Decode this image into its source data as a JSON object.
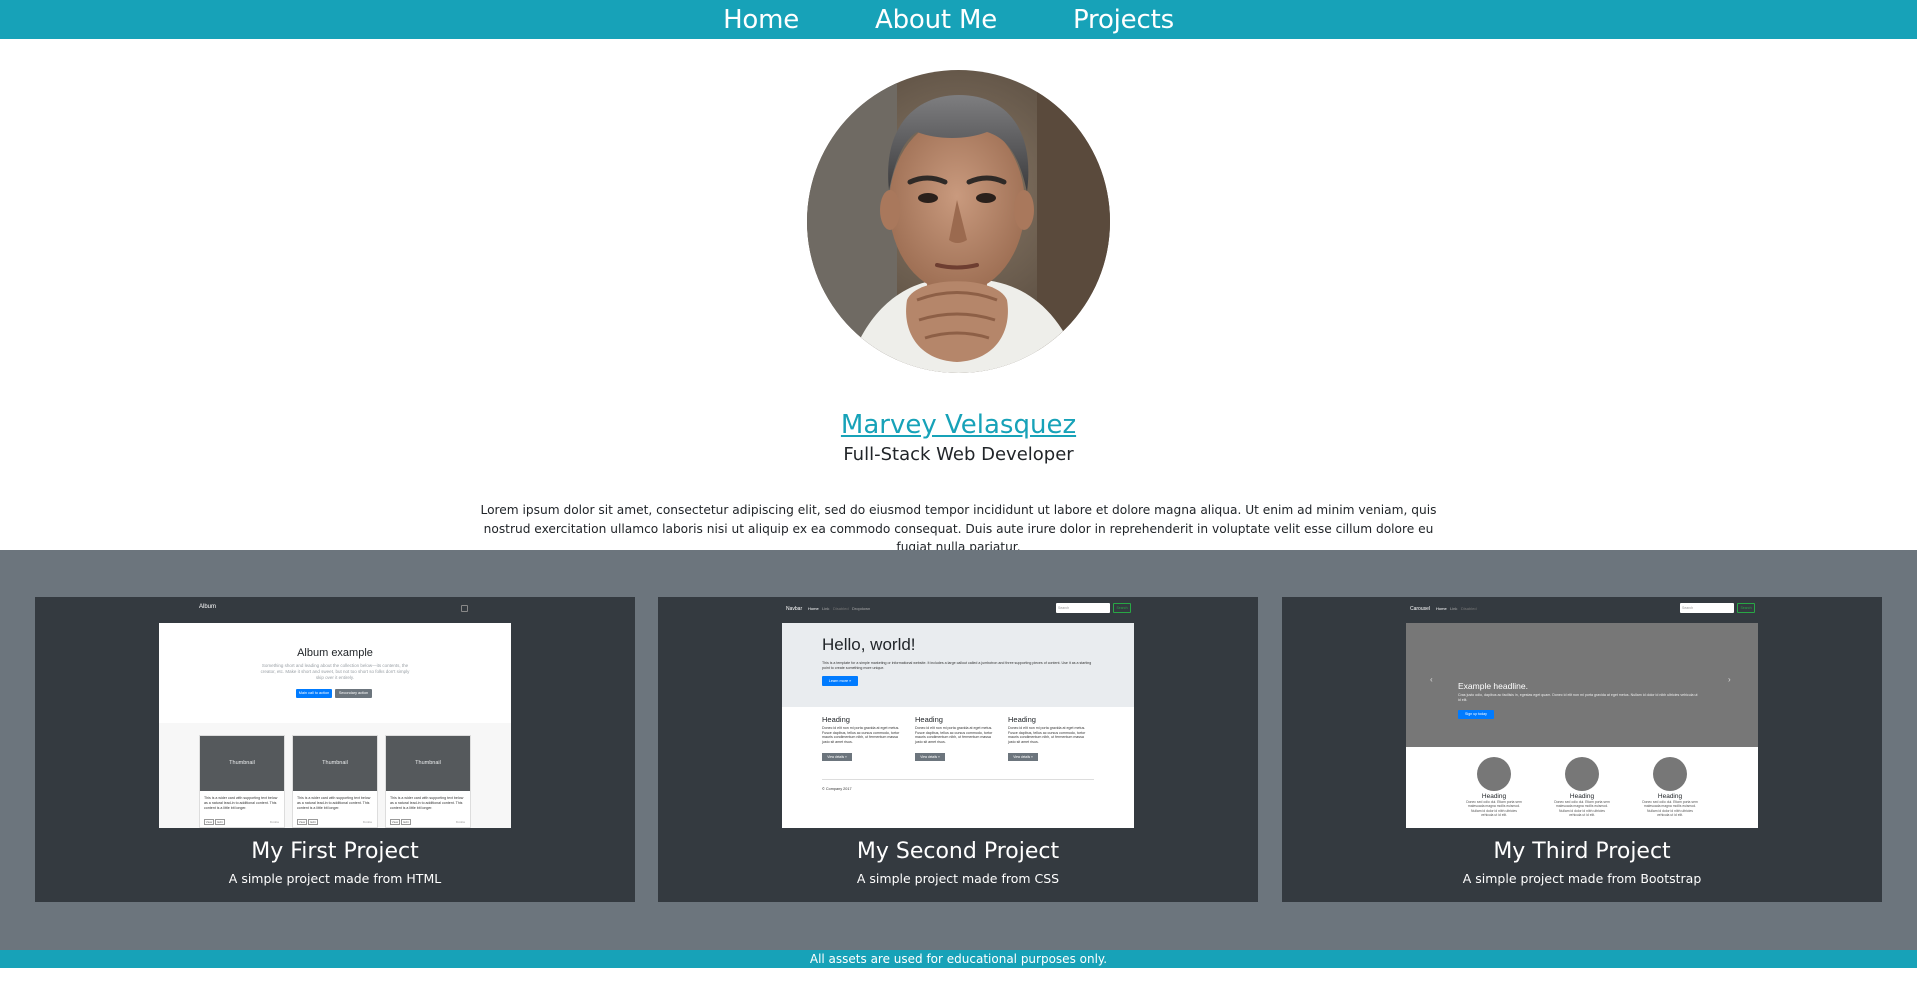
{
  "nav": {
    "items": [
      {
        "label": "Home"
      },
      {
        "label": "About Me"
      },
      {
        "label": "Projects"
      }
    ]
  },
  "profile": {
    "name": "Marvey Velasquez",
    "role": "Full-Stack Web Developer",
    "bio": "Lorem ipsum dolor sit amet, consectetur adipiscing elit, sed do eiusmod tempor incididunt ut labore et dolore magna aliqua. Ut enim ad minim veniam, quis nostrud exercitation ullamco laboris nisi ut aliquip ex ea commodo consequat. Duis aute irure dolor in reprehenderit in voluptate velit esse cillum dolore eu fugiat nulla pariatur."
  },
  "projects": [
    {
      "title": "My First Project",
      "description": "A simple project made from HTML",
      "thumb": {
        "brand": "Album",
        "heading": "Album example",
        "lead": "Something short and leading about the collection below—its contents, the creator, etc. Make it short and sweet, but not too short so folks don't simply skip over it entirely.",
        "primary_btn": "Main call to action",
        "secondary_btn": "Secondary action",
        "card_label": "Thumbnail",
        "card_text": "This is a wider card with supporting text below as a natural lead-in to additional content. This content is a little bit longer.",
        "view": "View",
        "edit": "Edit",
        "mins": "9 mins"
      }
    },
    {
      "title": "My Second Project",
      "description": "A simple project made from CSS",
      "thumb": {
        "brand": "Navbar",
        "nav_home": "Home",
        "nav_link": "Link",
        "nav_disabled": "Disabled",
        "nav_dropdown": "Dropdown",
        "search": "Search",
        "search_btn": "Search",
        "heading": "Hello, world!",
        "lead": "This is a template for a simple marketing or informational website. It includes a large callout called a jumbotron and three supporting pieces of content. Use it as a starting point to create something more unique.",
        "learn_btn": "Learn more »",
        "col_heading": "Heading",
        "col_text": "Donec id elit non mi porta gravida at eget metus. Fusce dapibus, tellus ac cursus commodo, tortor mauris condimentum nibh, ut fermentum massa justo sit amet risus.",
        "details_btn": "View details »",
        "footer": "© Company 2017"
      }
    },
    {
      "title": "My Third Project",
      "description": "A simple project made from Bootstrap",
      "thumb": {
        "brand": "Carousel",
        "nav_home": "Home",
        "nav_link": "Link",
        "nav_disabled": "Disabled",
        "search": "Search",
        "search_btn": "Search",
        "headline": "Example headline.",
        "caption": "Cras justo odio, dapibus ac facilisis in, egestas eget quam. Donec id elit non mi porta gravida at eget metus. Nullam id dolor id nibh ultricies vehicula ut id elit.",
        "signup_btn": "Sign up today",
        "col_heading": "Heading",
        "col_text": "Donec sed odio dui. Etiam porta sem malesuada magna mollis euismod. Nullam id dolor id nibh ultricies vehicula ut id elit."
      }
    }
  ],
  "footer": {
    "text": "All assets are used for educational purposes only."
  },
  "colors": {
    "primary": "#17a2b8",
    "band": "#6c757d",
    "card": "#343a40"
  }
}
